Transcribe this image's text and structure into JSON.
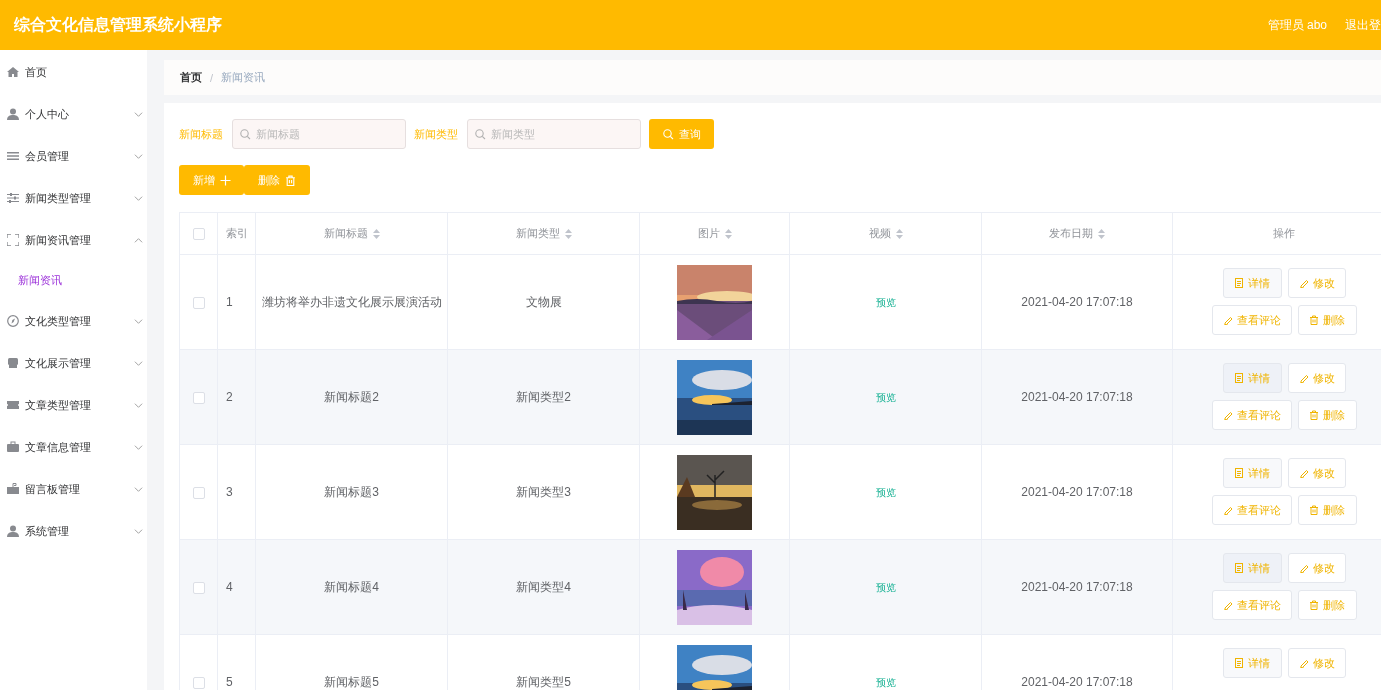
{
  "header": {
    "title": "综合文化信息管理系统小程序",
    "user": "管理员 abo",
    "logout": "退出登"
  },
  "sidebar": {
    "items": [
      {
        "label": "首页"
      },
      {
        "label": "个人中心",
        "expanded": false
      },
      {
        "label": "会员管理",
        "expanded": false
      },
      {
        "label": "新闻类型管理",
        "expanded": false
      },
      {
        "label": "新闻资讯管理",
        "expanded": true,
        "children": [
          {
            "label": "新闻资讯",
            "selected": true
          }
        ]
      },
      {
        "label": "文化类型管理",
        "expanded": false
      },
      {
        "label": "文化展示管理",
        "expanded": false
      },
      {
        "label": "文章类型管理",
        "expanded": false
      },
      {
        "label": "文章信息管理",
        "expanded": false
      },
      {
        "label": "留言板管理",
        "expanded": false
      },
      {
        "label": "系统管理",
        "expanded": false
      }
    ]
  },
  "breadcrumb": {
    "items": [
      "首页",
      "新闻资讯"
    ],
    "separator": "/"
  },
  "search": {
    "fields": [
      {
        "label": "新闻标题",
        "placeholder": "新闻标题"
      },
      {
        "label": "新闻类型",
        "placeholder": "新闻类型"
      }
    ],
    "button": "查询"
  },
  "toolbar": [
    {
      "label": "新增",
      "kind": "add"
    },
    {
      "label": "删除",
      "kind": "delete"
    }
  ],
  "table": {
    "select_all": {
      "checked": false
    },
    "columns": [
      {
        "label": "索引",
        "sortable": false
      },
      {
        "label": "新闻标题",
        "sortable": true
      },
      {
        "label": "新闻类型",
        "sortable": true
      },
      {
        "label": "图片",
        "sortable": true
      },
      {
        "label": "视频",
        "sortable": true
      },
      {
        "label": "发布日期",
        "sortable": true
      },
      {
        "label": "操作",
        "sortable": false
      }
    ],
    "rows": [
      {
        "checked": false,
        "index": "1",
        "title": "潍坊将举办非遗文化展示展演活动",
        "type": "文物展",
        "picture": {
          "kind": "picture"
        },
        "video": "预览",
        "date": "2021-04-20 17:07:18",
        "actions": [
          {
            "label": "详情",
            "kind": "detail"
          },
          {
            "label": "修改",
            "kind": "edit"
          },
          {
            "label": "查看评论",
            "kind": "edit"
          },
          {
            "label": "删除",
            "kind": "delete"
          }
        ]
      },
      {
        "checked": false,
        "index": "2",
        "title": "新闻标题2",
        "type": "新闻类型2",
        "picture": {
          "kind": "picture"
        },
        "video": "预览",
        "date": "2021-04-20 17:07:18",
        "actions": [
          {
            "label": "详情",
            "kind": "detail"
          },
          {
            "label": "修改",
            "kind": "edit"
          },
          {
            "label": "查看评论",
            "kind": "edit"
          },
          {
            "label": "删除",
            "kind": "delete"
          }
        ]
      },
      {
        "checked": false,
        "index": "3",
        "title": "新闻标题3",
        "type": "新闻类型3",
        "picture": {
          "kind": "picture"
        },
        "video": "预览",
        "date": "2021-04-20 17:07:18",
        "actions": [
          {
            "label": "详情",
            "kind": "detail"
          },
          {
            "label": "修改",
            "kind": "edit"
          },
          {
            "label": "查看评论",
            "kind": "edit"
          },
          {
            "label": "删除",
            "kind": "delete"
          }
        ]
      },
      {
        "checked": false,
        "index": "4",
        "title": "新闻标题4",
        "type": "新闻类型4",
        "picture": {
          "kind": "picture"
        },
        "video": "预览",
        "date": "2021-04-20 17:07:18",
        "actions": [
          {
            "label": "详情",
            "kind": "detail"
          },
          {
            "label": "修改",
            "kind": "edit"
          },
          {
            "label": "查看评论",
            "kind": "edit"
          },
          {
            "label": "删除",
            "kind": "delete"
          }
        ]
      },
      {
        "checked": false,
        "index": "5",
        "title": "新闻标题5",
        "type": "新闻类型5",
        "picture": {
          "kind": "picture"
        },
        "video": "预览",
        "date": "2021-04-20 17:07:18",
        "actions": [
          {
            "label": "详情",
            "kind": "detail"
          },
          {
            "label": "修改",
            "kind": "edit"
          }
        ]
      }
    ]
  }
}
